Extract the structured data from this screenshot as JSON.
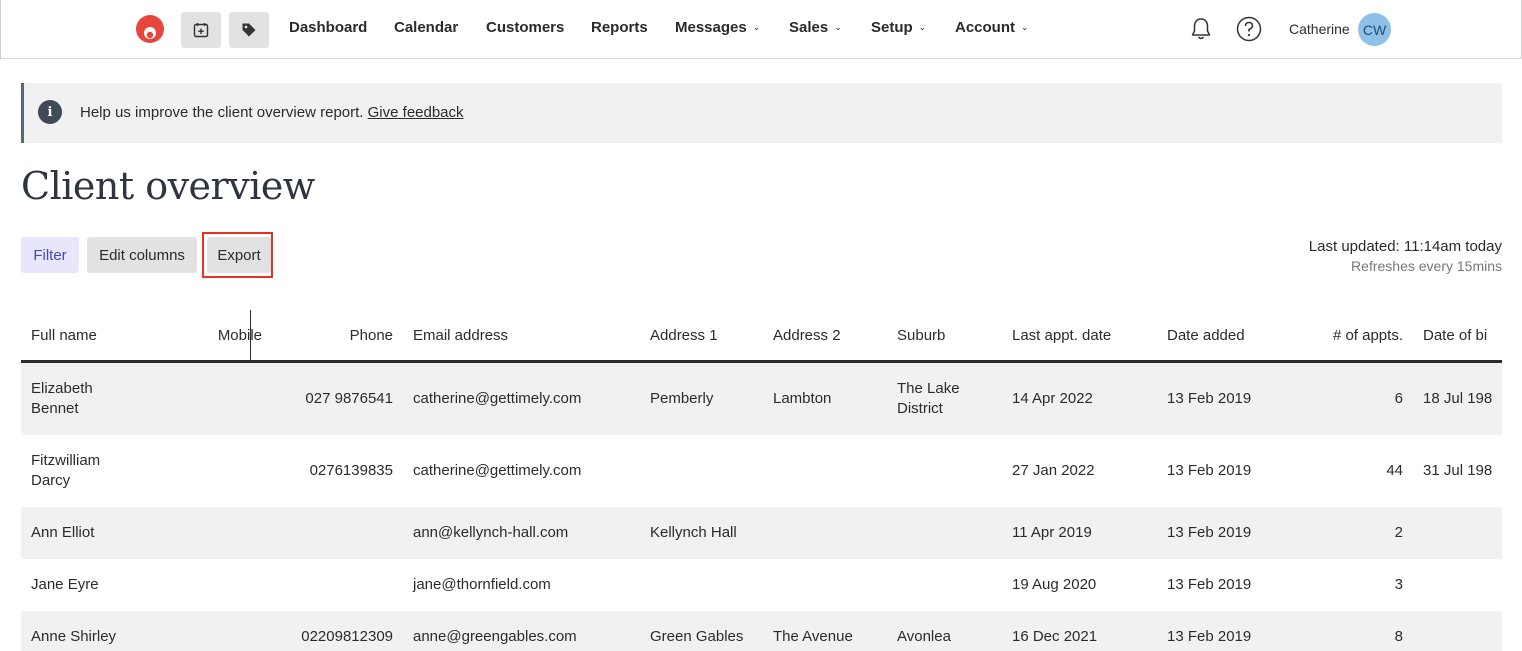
{
  "nav": {
    "items": [
      {
        "label": "Dashboard",
        "dropdown": false
      },
      {
        "label": "Calendar",
        "dropdown": false
      },
      {
        "label": "Customers",
        "dropdown": false
      },
      {
        "label": "Reports",
        "dropdown": false
      },
      {
        "label": "Messages",
        "dropdown": true
      },
      {
        "label": "Sales",
        "dropdown": true
      },
      {
        "label": "Setup",
        "dropdown": true
      },
      {
        "label": "Account",
        "dropdown": true
      }
    ],
    "user_name": "Catherine",
    "avatar_initials": "CW",
    "brand_color": "#e8453c",
    "icons": [
      "logo-icon",
      "calendar-add-icon",
      "tag-icon",
      "bell-icon",
      "help-icon"
    ]
  },
  "banner": {
    "message": "Help us improve the client overview report.",
    "link_label": "Give feedback"
  },
  "page": {
    "title": "Client overview",
    "buttons": {
      "filter": "Filter",
      "edit_columns": "Edit columns",
      "export": "Export"
    },
    "last_updated": "Last updated: 11:14am today",
    "refresh_note": "Refreshes every 15mins"
  },
  "table": {
    "columns": [
      "Full name",
      "Mobile",
      "Phone",
      "Email address",
      "Address 1",
      "Address 2",
      "Suburb",
      "Last appt. date",
      "Date added",
      "# of appts.",
      "Date of bi"
    ],
    "rows": [
      {
        "name": "Elizabeth Bennet",
        "mobile": "",
        "phone": "027 9876541",
        "email": "catherine@gettimely.com",
        "address1": "Pemberly",
        "address2": "Lambton",
        "suburb": "The Lake District",
        "last_appt": "14 Apr 2022",
        "date_added": "13 Feb 2019",
        "appts": "6",
        "dob": "18 Jul 198"
      },
      {
        "name": "Fitzwilliam Darcy",
        "mobile": "",
        "phone": "0276139835",
        "email": "catherine@gettimely.com",
        "address1": "",
        "address2": "",
        "suburb": "",
        "last_appt": "27 Jan 2022",
        "date_added": "13 Feb 2019",
        "appts": "44",
        "dob": "31 Jul 198"
      },
      {
        "name": "Ann Elliot",
        "mobile": "",
        "phone": "",
        "email": "ann@kellynch-hall.com",
        "address1": "Kellynch Hall",
        "address2": "",
        "suburb": "",
        "last_appt": "11 Apr 2019",
        "date_added": "13 Feb 2019",
        "appts": "2",
        "dob": ""
      },
      {
        "name": "Jane Eyre",
        "mobile": "",
        "phone": "",
        "email": "jane@thornfield.com",
        "address1": "",
        "address2": "",
        "suburb": "",
        "last_appt": "19 Aug 2020",
        "date_added": "13 Feb 2019",
        "appts": "3",
        "dob": ""
      },
      {
        "name": "Anne Shirley",
        "mobile": "",
        "phone": "02209812309",
        "email": "anne@greengables.com",
        "address1": "Green Gables",
        "address2": "The Avenue",
        "suburb": "Avonlea",
        "last_appt": "16 Dec 2021",
        "date_added": "13 Feb 2019",
        "appts": "8",
        "dob": ""
      }
    ]
  }
}
